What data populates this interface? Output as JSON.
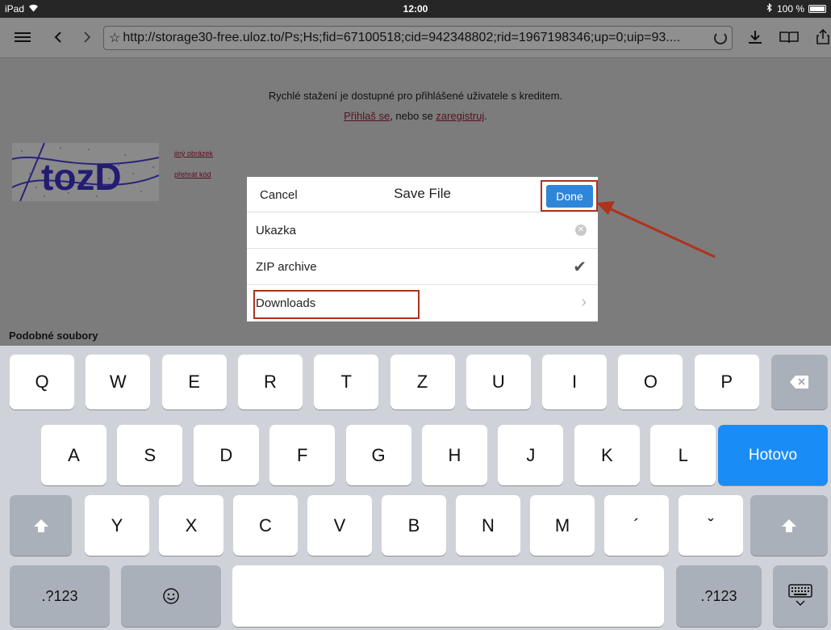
{
  "status": {
    "device": "iPad",
    "time": "12:00",
    "battery": "100 %"
  },
  "toolbar": {
    "url": "http://storage30-free.uloz.to/Ps;Hs;fid=67100518;cid=942348802;rid=1967198346;up=0;uip=93...."
  },
  "page": {
    "notice": "Rychlé stažení je dostupné pro přihlášené uživatele s kreditem.",
    "login_link": "Přihlaš se",
    "or_text": ", nebo se ",
    "register_link": "zaregistruj",
    "period": ".",
    "captcha_text": "tozD",
    "other_image": "jiný obrázek",
    "play_code": "přehrát kód",
    "similar_files": "Podobné soubory"
  },
  "dialog": {
    "cancel": "Cancel",
    "title": "Save File",
    "done": "Done",
    "filename": "Ukazka",
    "format": "ZIP archive",
    "location": "Downloads"
  },
  "keyboard": {
    "row1": [
      "Q",
      "W",
      "E",
      "R",
      "T",
      "Z",
      "U",
      "I",
      "O",
      "P"
    ],
    "row2": [
      "A",
      "S",
      "D",
      "F",
      "G",
      "H",
      "J",
      "K",
      "L"
    ],
    "row3": [
      "Y",
      "X",
      "C",
      "V",
      "B",
      "N",
      "M",
      "´",
      "ˇ"
    ],
    "done": "Hotovo",
    "numbers": ".?123",
    "numbers_right": ".?123"
  },
  "colors": {
    "accent": "#2e86d8",
    "highlight": "#b0321e",
    "keyboard_blue": "#1a8cf5"
  }
}
